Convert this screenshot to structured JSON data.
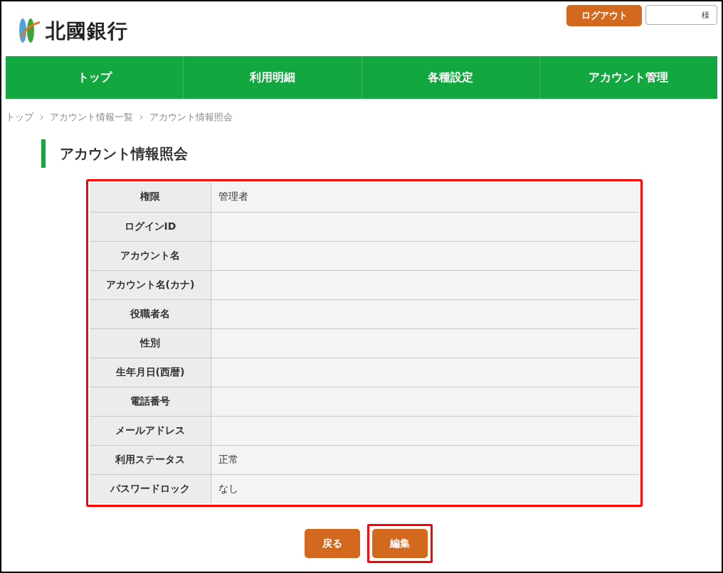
{
  "header": {
    "logo_text": "北國銀行",
    "logout_button": "ログアウト",
    "user_field": {
      "suffix": "様"
    }
  },
  "nav": [
    {
      "label": "トップ"
    },
    {
      "label": "利用明細"
    },
    {
      "label": "各種設定"
    },
    {
      "label": "アカウント管理"
    }
  ],
  "breadcrumb": [
    "トップ",
    "アカウント情報一覧",
    "アカウント情報照会"
  ],
  "page_title": "アカウント情報照会",
  "table": {
    "highlighted": true,
    "rows": [
      {
        "label": "権限",
        "value": "管理者"
      },
      {
        "label": "ログインID"
      },
      {
        "label": "アカウント名"
      },
      {
        "label": "アカウント名(カナ)"
      },
      {
        "label": "役職者名"
      },
      {
        "label": "性別"
      },
      {
        "label": "生年月日(西暦)"
      },
      {
        "label": "電話番号"
      },
      {
        "label": "メールアドレス"
      },
      {
        "label": "利用ステータス",
        "value": "正常"
      },
      {
        "label": "パスワードロック",
        "value": "なし"
      }
    ]
  },
  "buttons": [
    {
      "label": "戻る",
      "highlighted": false
    },
    {
      "label": "編集",
      "highlighted": true
    }
  ]
}
